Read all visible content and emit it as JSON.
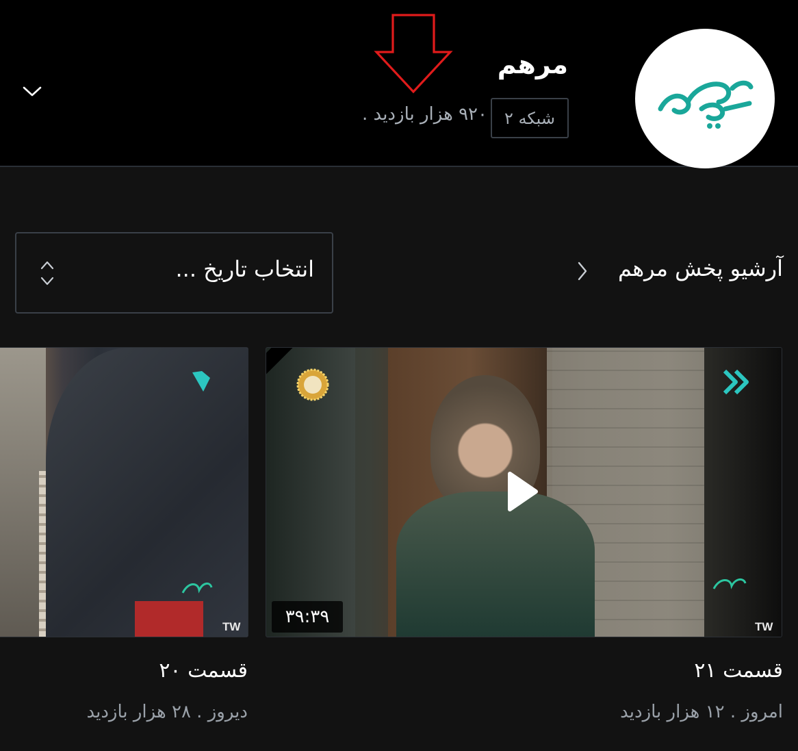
{
  "header": {
    "channel_title": "مرهم",
    "network": "شبکه ۲",
    "views": "۹۲۰ هزار بازدید",
    "separator": "."
  },
  "archive": {
    "title": "آرشیو پخش مرهم",
    "date_select_placeholder": "انتخاب تاریخ ..."
  },
  "episodes": [
    {
      "title": "قسمت ۲۱",
      "duration": "۳۹:۳۹",
      "meta": "امروز . ۱۲ هزار بازدید",
      "watermark": "TW"
    },
    {
      "title": "قسمت ۲۰",
      "meta": "دیروز . ۲۸ هزار بازدید",
      "watermark": "TW"
    }
  ],
  "icons": {
    "collapse": "chevron-down-icon",
    "archive": "chevron-right-icon",
    "date_select": "sort-updown-icon",
    "play": "play-icon",
    "annotation": "red-down-arrow-icon"
  },
  "colors": {
    "header_bg": "#000000",
    "body_bg": "#121212",
    "muted_text": "#a9b0b8",
    "brand_teal": "#1aa79a",
    "annotation_red": "#e01b1b"
  }
}
